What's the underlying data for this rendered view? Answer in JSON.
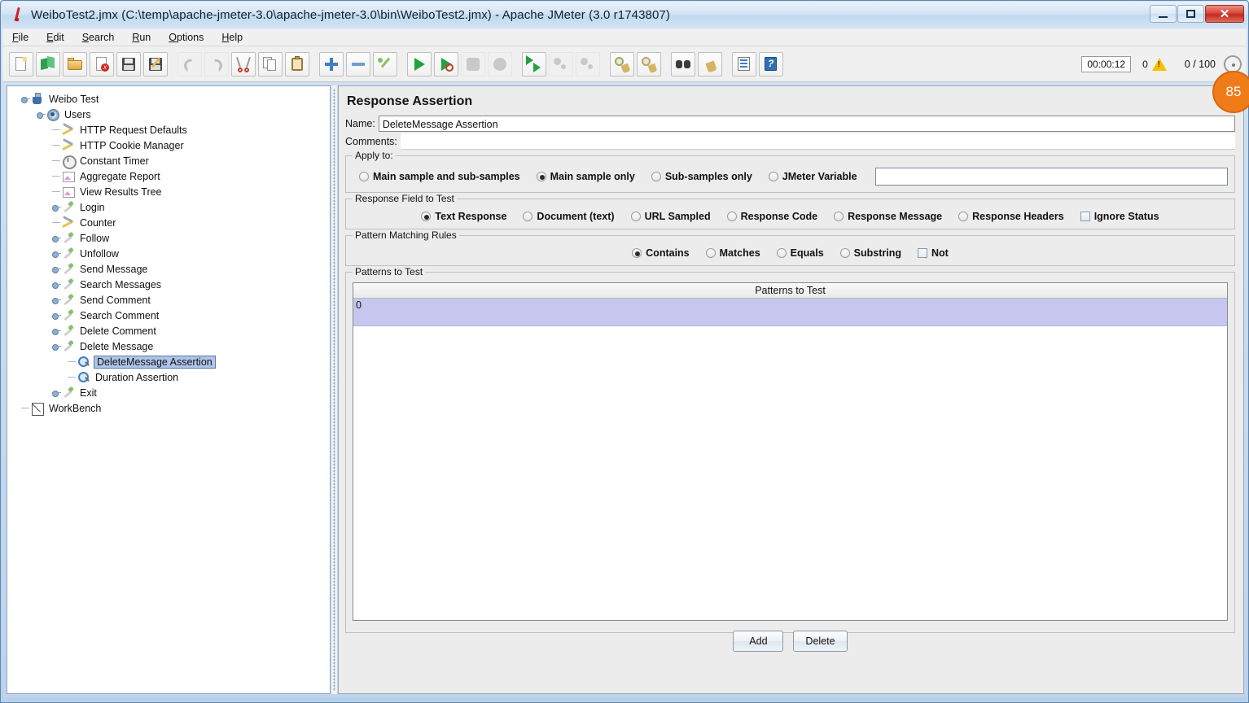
{
  "window": {
    "title": "WeiboTest2.jmx (C:\\temp\\apache-jmeter-3.0\\apache-jmeter-3.0\\bin\\WeiboTest2.jmx) - Apache JMeter (3.0 r1743807)",
    "minimize_label": "–",
    "maximize_label": "□",
    "close_label": "✕"
  },
  "menu": [
    {
      "label": "File",
      "mnemonic": "F"
    },
    {
      "label": "Edit",
      "mnemonic": "E"
    },
    {
      "label": "Search",
      "mnemonic": "S"
    },
    {
      "label": "Run",
      "mnemonic": "R"
    },
    {
      "label": "Options",
      "mnemonic": "O"
    },
    {
      "label": "Help",
      "mnemonic": "H"
    }
  ],
  "toolbar": {
    "buttons": [
      {
        "name": "new-button",
        "icon": "new-document-icon"
      },
      {
        "name": "templates-button",
        "icon": "templates-icon"
      },
      {
        "name": "open-button",
        "icon": "open-folder-icon"
      },
      {
        "name": "close-button",
        "icon": "close-document-icon"
      },
      {
        "name": "save-button",
        "icon": "save-floppy-icon"
      },
      {
        "name": "save-as-button",
        "icon": "save-as-icon"
      },
      {
        "name": "undo-button",
        "icon": "undo-arrow-icon"
      },
      {
        "name": "redo-button",
        "icon": "redo-arrow-icon"
      },
      {
        "name": "cut-button",
        "icon": "scissors-icon"
      },
      {
        "name": "copy-button",
        "icon": "copy-pages-icon"
      },
      {
        "name": "paste-button",
        "icon": "clipboard-icon"
      },
      {
        "name": "expand-all-button",
        "icon": "plus-icon"
      },
      {
        "name": "collapse-all-button",
        "icon": "minus-icon"
      },
      {
        "name": "toggle-button",
        "icon": "toggle-icon"
      },
      {
        "name": "start-button",
        "icon": "play-green-icon"
      },
      {
        "name": "start-no-pauses-button",
        "icon": "play-no-pause-icon"
      },
      {
        "name": "stop-button",
        "icon": "stop-sign-icon"
      },
      {
        "name": "shutdown-button",
        "icon": "shutdown-circle-icon"
      },
      {
        "name": "start-remote-button",
        "icon": "remote-start-icon"
      },
      {
        "name": "stop-remote-button",
        "icon": "remote-stop-icon"
      },
      {
        "name": "shutdown-remote-button",
        "icon": "remote-shutdown-icon"
      },
      {
        "name": "clear-button",
        "icon": "clear-broom-icon"
      },
      {
        "name": "clear-all-button",
        "icon": "clear-all-broom-icon"
      },
      {
        "name": "search-button",
        "icon": "binoculars-icon"
      },
      {
        "name": "reset-search-button",
        "icon": "reset-broom-icon"
      },
      {
        "name": "function-helper-button",
        "icon": "function-list-icon"
      },
      {
        "name": "help-button",
        "icon": "help-book-icon"
      }
    ],
    "status": {
      "elapsed_time": "00:00:12",
      "warning_count": "0",
      "thread_count": "0 / 100",
      "badge": "85"
    }
  },
  "tree": {
    "nodes": [
      {
        "label": "Weibo Test",
        "depth": 0,
        "icon": "test-plan-icon",
        "expander": "expanded",
        "selected": false
      },
      {
        "label": "Users",
        "depth": 1,
        "icon": "thread-group-icon",
        "expander": "expanded",
        "selected": false
      },
      {
        "label": "HTTP Request Defaults",
        "depth": 2,
        "icon": "config-element-icon",
        "expander": "none",
        "selected": false
      },
      {
        "label": "HTTP Cookie Manager",
        "depth": 2,
        "icon": "config-element-icon",
        "expander": "none",
        "selected": false
      },
      {
        "label": "Constant Timer",
        "depth": 2,
        "icon": "timer-icon",
        "expander": "none",
        "selected": false
      },
      {
        "label": "Aggregate Report",
        "depth": 2,
        "icon": "listener-icon",
        "expander": "none",
        "selected": false
      },
      {
        "label": "View Results Tree",
        "depth": 2,
        "icon": "listener-icon",
        "expander": "none",
        "selected": false
      },
      {
        "label": "Login",
        "depth": 2,
        "icon": "sampler-icon",
        "expander": "collapsed",
        "selected": false
      },
      {
        "label": "Counter",
        "depth": 2,
        "icon": "config-element-icon",
        "expander": "none",
        "selected": false
      },
      {
        "label": "Follow",
        "depth": 2,
        "icon": "sampler-icon",
        "expander": "collapsed",
        "selected": false
      },
      {
        "label": "Unfollow",
        "depth": 2,
        "icon": "sampler-icon",
        "expander": "collapsed",
        "selected": false
      },
      {
        "label": "Send Message",
        "depth": 2,
        "icon": "sampler-icon",
        "expander": "collapsed",
        "selected": false
      },
      {
        "label": "Search Messages",
        "depth": 2,
        "icon": "sampler-icon",
        "expander": "collapsed",
        "selected": false
      },
      {
        "label": "Send Comment",
        "depth": 2,
        "icon": "sampler-icon",
        "expander": "collapsed",
        "selected": false
      },
      {
        "label": "Search Comment",
        "depth": 2,
        "icon": "sampler-icon",
        "expander": "collapsed",
        "selected": false
      },
      {
        "label": "Delete Comment",
        "depth": 2,
        "icon": "sampler-icon",
        "expander": "collapsed",
        "selected": false
      },
      {
        "label": "Delete Message",
        "depth": 2,
        "icon": "sampler-icon",
        "expander": "expanded",
        "selected": false
      },
      {
        "label": "DeleteMessage Assertion",
        "depth": 3,
        "icon": "assertion-icon",
        "expander": "none",
        "selected": true
      },
      {
        "label": "Duration Assertion",
        "depth": 3,
        "icon": "assertion-icon",
        "expander": "none",
        "selected": false
      },
      {
        "label": "Exit",
        "depth": 2,
        "icon": "sampler-icon",
        "expander": "collapsed",
        "selected": false
      },
      {
        "label": "WorkBench",
        "depth": 0,
        "icon": "workbench-icon",
        "expander": "none",
        "selected": false
      }
    ]
  },
  "panel": {
    "title": "Response Assertion",
    "name_label": "Name:",
    "name_value": "DeleteMessage Assertion",
    "comments_label": "Comments:",
    "comments_value": "",
    "apply_to": {
      "title": "Apply to:",
      "options": [
        {
          "label": "Main sample and sub-samples",
          "selected": false
        },
        {
          "label": "Main sample only",
          "selected": true
        },
        {
          "label": "Sub-samples only",
          "selected": false
        },
        {
          "label": "JMeter Variable",
          "selected": false
        }
      ],
      "variable_value": ""
    },
    "response_field": {
      "title": "Response Field to Test",
      "options": [
        {
          "label": "Text Response",
          "selected": true
        },
        {
          "label": "Document (text)",
          "selected": false
        },
        {
          "label": "URL Sampled",
          "selected": false
        },
        {
          "label": "Response Code",
          "selected": false
        },
        {
          "label": "Response Message",
          "selected": false
        },
        {
          "label": "Response Headers",
          "selected": false
        }
      ],
      "ignore_status": {
        "label": "Ignore Status",
        "checked": false
      }
    },
    "pattern_rules": {
      "title": "Pattern Matching Rules",
      "options": [
        {
          "label": "Contains",
          "selected": true
        },
        {
          "label": "Matches",
          "selected": false
        },
        {
          "label": "Equals",
          "selected": false
        },
        {
          "label": "Substring",
          "selected": false
        }
      ],
      "not": {
        "label": "Not",
        "checked": false
      }
    },
    "patterns": {
      "title": "Patterns to Test",
      "column_header": "Patterns to Test",
      "rows": [
        {
          "value": "0",
          "selected": true
        }
      ],
      "add_label": "Add",
      "delete_label": "Delete"
    }
  },
  "colors": {
    "selection_blue": "#b0c4e8",
    "table_row_lavender": "#c6c6ee",
    "badge_orange": "#f07c19",
    "panel_grey": "#ececec"
  }
}
